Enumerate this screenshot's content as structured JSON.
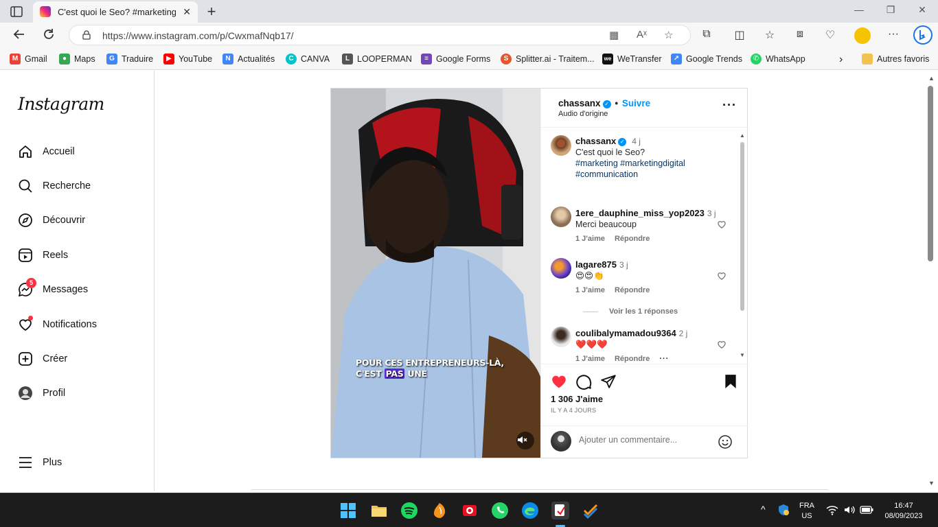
{
  "browser": {
    "tab_title": "C'est quoi le Seo? #marketing #r",
    "url": "https://www.instagram.com/p/CwxmafNqb17/",
    "bookmarks": [
      {
        "label": "Gmail",
        "color": "#ea4335",
        "glyph": "M"
      },
      {
        "label": "Maps",
        "color": "#34a853",
        "glyph": "●"
      },
      {
        "label": "Traduire",
        "color": "#4285f4",
        "glyph": "G"
      },
      {
        "label": "YouTube",
        "color": "#ff0000",
        "glyph": "▶"
      },
      {
        "label": "Actualités",
        "color": "#4285f4",
        "glyph": "N"
      },
      {
        "label": "CANVA",
        "color": "#00c4cc",
        "glyph": "C"
      },
      {
        "label": "LOOPERMAN",
        "color": "#555555",
        "glyph": "L"
      },
      {
        "label": "Google Forms",
        "color": "#7248b9",
        "glyph": "≡"
      },
      {
        "label": "Splitter.ai - Traitem...",
        "color": "#e4572e",
        "glyph": "S"
      },
      {
        "label": "WeTransfer",
        "color": "#111111",
        "glyph": "we"
      },
      {
        "label": "Google Trends",
        "color": "#4285f4",
        "glyph": "↗"
      },
      {
        "label": "WhatsApp",
        "color": "#25d366",
        "glyph": "✆"
      }
    ],
    "other_favorites": "Autres favoris"
  },
  "instagram": {
    "logo": "Instagram",
    "nav": [
      {
        "label": "Accueil",
        "icon": "home-icon"
      },
      {
        "label": "Recherche",
        "icon": "search-icon"
      },
      {
        "label": "Découvrir",
        "icon": "compass-icon"
      },
      {
        "label": "Reels",
        "icon": "reels-icon"
      },
      {
        "label": "Messages",
        "icon": "messenger-icon",
        "badge": "5"
      },
      {
        "label": "Notifications",
        "icon": "heart-icon"
      },
      {
        "label": "Créer",
        "icon": "plus-square-icon"
      },
      {
        "label": "Profil",
        "icon": "avatar-icon"
      }
    ],
    "more": "Plus"
  },
  "post": {
    "author": "chassanx",
    "follow": "Suivre",
    "separator": "•",
    "audio": "Audio d'origine",
    "caption_time": "4 j",
    "caption_text": "C'est quoi le Seo?",
    "caption_tags": "#marketing #marketingdigital",
    "caption_tags2": "#communication",
    "video_caption_line1": "POUR CES ENTREPRENEURS-LÀ,",
    "video_caption_line2_a": "C'EST ",
    "video_caption_line2_hl": "PAS",
    "video_caption_line2_b": " UNE",
    "comments": [
      {
        "user": "1ere_dauphine_miss_yop2023",
        "time": "3 j",
        "text": "Merci beaucoup",
        "likes": "1 J'aime",
        "reply": "Répondre"
      },
      {
        "user": "lagare875",
        "time": "3 j",
        "text": "😍😍👏",
        "likes": "1 J'aime",
        "reply": "Répondre"
      },
      {
        "user": "coulibalymamadou9364",
        "time": "2 j",
        "text": "❤️❤️❤️",
        "likes": "1 J'aime",
        "reply": "Répondre"
      }
    ],
    "view_replies": "Voir les 1 réponses",
    "like_count": "1 306 J'aime",
    "posted": "IL Y A 4 JOURS",
    "comment_placeholder": "Ajouter un commentaire..."
  },
  "taskbar": {
    "lang": "FRA",
    "region": "US",
    "time": "16:47",
    "date": "08/09/2023"
  }
}
